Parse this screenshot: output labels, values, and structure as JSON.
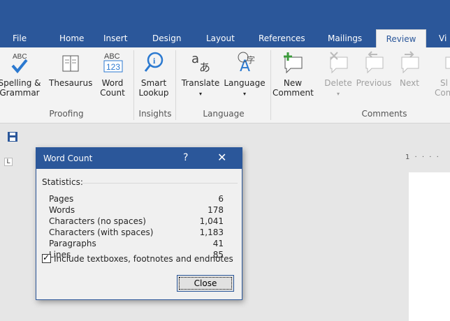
{
  "ribbon_tabs": [
    "File",
    "Home",
    "Insert",
    "Design",
    "Layout",
    "References",
    "Mailings",
    "Review",
    "Vi"
  ],
  "ribbon": {
    "spelling": "Spelling &\nGrammar",
    "spelling_l1": "Spelling &",
    "spelling_l2": "Grammar",
    "thesaurus": "Thesaurus",
    "wordcount_l1": "Word",
    "wordcount_l2": "Count",
    "smart_l1": "Smart",
    "smart_l2": "Lookup",
    "translate": "Translate",
    "language": "Language",
    "new_l1": "New",
    "new_l2": "Comment",
    "delete": "Delete",
    "previous": "Previous",
    "next": "Next",
    "show_partial_l1": "Sl",
    "show_partial_l2": "Com",
    "groups": {
      "proofing": "Proofing",
      "insights": "Insights",
      "language": "Language",
      "comments": "Comments"
    },
    "abc_label": "ABC",
    "abc123_label": "ABC",
    "num_label": "123"
  },
  "ruler_text": "1 · · · ·",
  "dialog": {
    "title": "Word Count",
    "help": "?",
    "close_x": "✕",
    "stats_header": "Statistics:",
    "stats": [
      {
        "label": "Pages",
        "value": "6"
      },
      {
        "label": "Words",
        "value": "178"
      },
      {
        "label": "Characters (no spaces)",
        "value": "1,041"
      },
      {
        "label": "Characters (with spaces)",
        "value": "1,183"
      },
      {
        "label": "Paragraphs",
        "value": "41"
      },
      {
        "label": "Lines",
        "value": "85"
      }
    ],
    "checkbox_label": "Include textboxes, footnotes and endnotes",
    "checkbox_checked": true,
    "close_button": "Close"
  },
  "colors": {
    "accent": "#2b579a",
    "ribbon_bg": "#f3f3f3",
    "doc_bg": "#e6e6e6"
  }
}
